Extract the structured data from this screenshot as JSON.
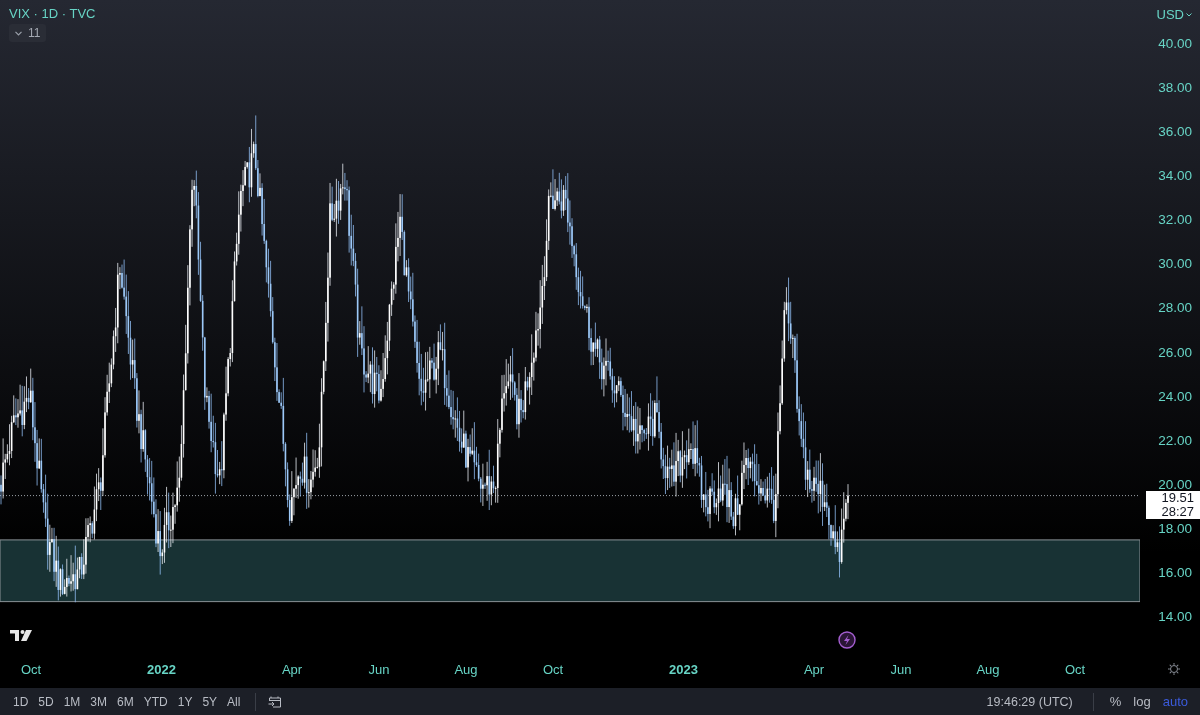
{
  "header": {
    "symbol": "VIX · 1D · TVC",
    "indicators_count": "11"
  },
  "price_axis": {
    "currency": "USD",
    "ticks": [
      "40.00",
      "38.00",
      "36.00",
      "34.00",
      "32.00",
      "30.00",
      "28.00",
      "26.00",
      "24.00",
      "22.00",
      "20.00",
      "18.00",
      "16.00",
      "14.00"
    ],
    "last_price": "19.51",
    "countdown": "28:27"
  },
  "time_axis": {
    "labels": [
      {
        "text": "Oct",
        "kind": "month"
      },
      {
        "text": "2022",
        "kind": "year"
      },
      {
        "text": "Apr",
        "kind": "month"
      },
      {
        "text": "Jun",
        "kind": "month"
      },
      {
        "text": "Aug",
        "kind": "month"
      },
      {
        "text": "Oct",
        "kind": "month"
      },
      {
        "text": "2023",
        "kind": "year"
      },
      {
        "text": "Apr",
        "kind": "month"
      },
      {
        "text": "Jun",
        "kind": "month"
      },
      {
        "text": "Aug",
        "kind": "month"
      },
      {
        "text": "Oct",
        "kind": "month"
      }
    ]
  },
  "toolbar": {
    "ranges": [
      "1D",
      "5D",
      "1M",
      "3M",
      "6M",
      "YTD",
      "1Y",
      "5Y",
      "All"
    ],
    "time": "19:46:29 (UTC)",
    "scale_options": [
      {
        "label": "%",
        "selected": false
      },
      {
        "label": "log",
        "selected": false
      },
      {
        "label": "auto",
        "selected": true
      }
    ]
  }
}
